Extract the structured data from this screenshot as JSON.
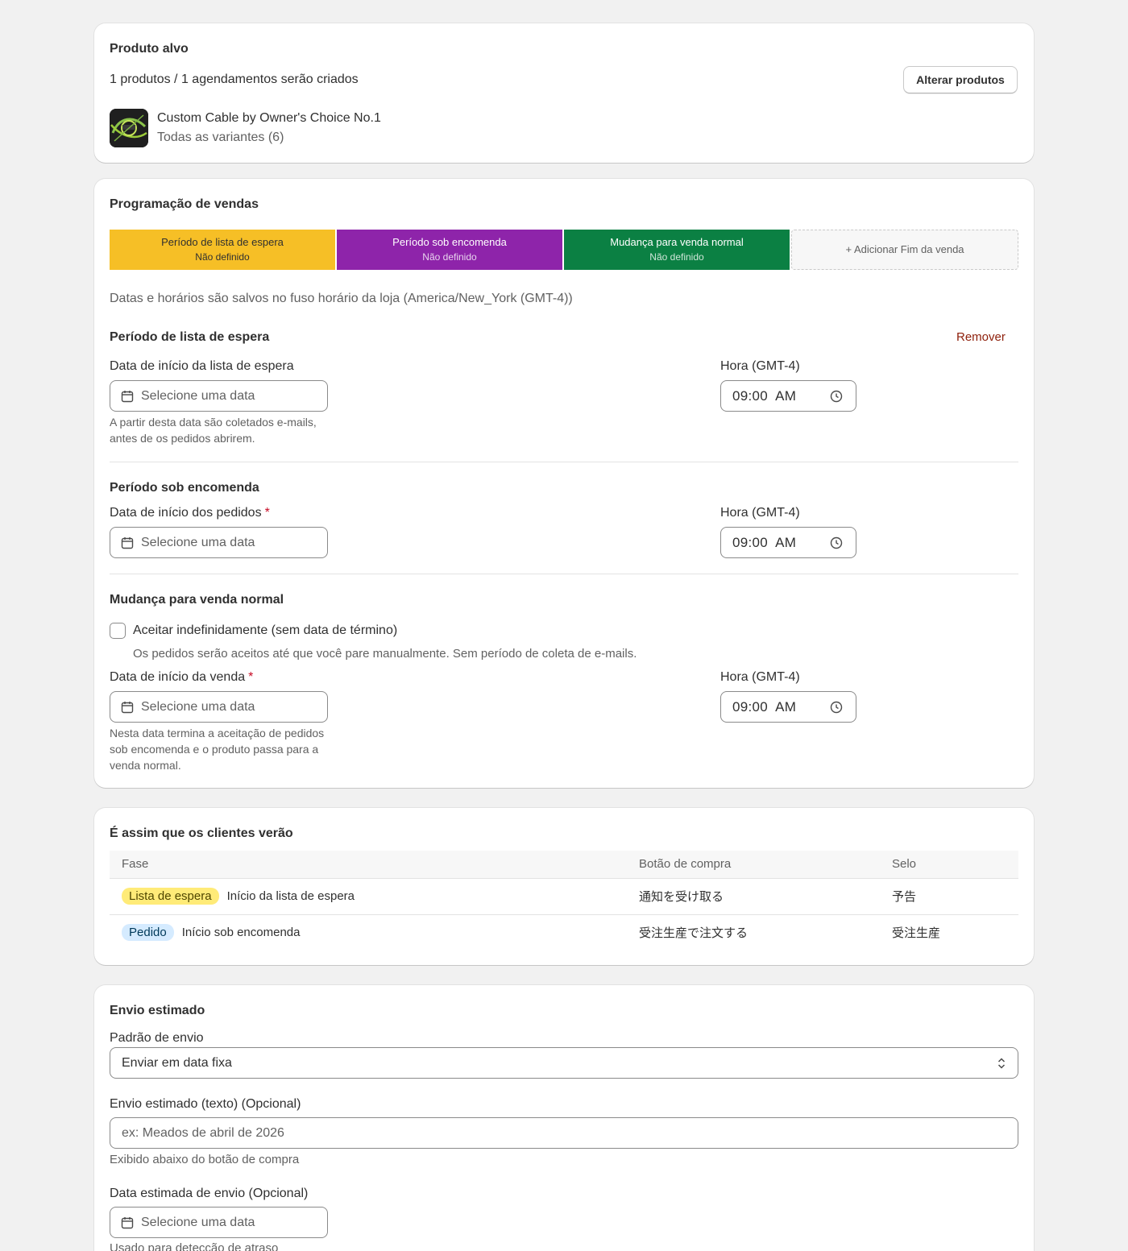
{
  "target_product": {
    "title": "Produto alvo",
    "summary": "1 produtos / 1 agendamentos serão criados",
    "change_button": "Alterar produtos",
    "product_name": "Custom Cable by Owner's Choice No.1",
    "variants": "Todas as variantes (6)"
  },
  "schedule": {
    "title": "Programação de vendas",
    "phases": [
      {
        "title": "Período de lista de espera",
        "status": "Não definido",
        "color": "#f6bf26",
        "text_color": "#303030"
      },
      {
        "title": "Período sob encomenda",
        "status": "Não definido",
        "color": "#8e24aa",
        "text_color": "#ffffff"
      },
      {
        "title": "Mudança para venda normal",
        "status": "Não definido",
        "color": "#0b8043",
        "text_color": "#ffffff"
      }
    ],
    "add_phase_label": "+ Adicionar Fim da venda",
    "timezone_note": "Datas e horários são salvos no fuso horário da loja (America/New_York (GMT-4))",
    "waitlist": {
      "title": "Período de lista de espera",
      "remove_label": "Remover",
      "start_label": "Data de início da lista de espera",
      "date_placeholder": "Selecione uma data",
      "help": "A partir desta data são coletados e-mails, antes de os pedidos abrirem.",
      "time_label": "Hora (GMT-4)",
      "time_value": "09:00  AM"
    },
    "preorder": {
      "title": "Período sob encomenda",
      "start_label": "Data de início dos pedidos",
      "required_mark": "*",
      "date_placeholder": "Selecione uma data",
      "time_label": "Hora (GMT-4)",
      "time_value": "09:00  AM"
    },
    "normal_sale": {
      "title": "Mudança para venda normal",
      "checkbox_label": "Aceitar indefinidamente (sem data de término)",
      "checkbox_help": "Os pedidos serão aceitos até que você pare manualmente. Sem período de coleta de e-mails.",
      "start_label": "Data de início da venda",
      "required_mark": "*",
      "date_placeholder": "Selecione uma data",
      "help": "Nesta data termina a aceitação de pedidos sob encomenda e o produto passa para a venda normal.",
      "time_label": "Hora (GMT-4)",
      "time_value": "09:00  AM"
    }
  },
  "preview": {
    "title": "É assim que os clientes verão",
    "columns": [
      "Fase",
      "Botão de compra",
      "Selo"
    ],
    "rows": [
      {
        "badge": "Lista de espera",
        "badge_color": "#ffeb78",
        "phase": "Início da lista de espera",
        "button": "通知を受け取る",
        "label": "予告"
      },
      {
        "badge": "Pedido",
        "badge_color": "#d5ebff",
        "phase": "Início sob encomenda",
        "button": "受注生産で注文する",
        "label": "受注生産"
      }
    ]
  },
  "shipping": {
    "title": "Envio estimado",
    "pattern_label": "Padrão de envio",
    "pattern_value": "Enviar em data fixa",
    "text_label": "Envio estimado (texto) (Opcional)",
    "text_placeholder": "ex: Meados de abril de 2026",
    "text_help": "Exibido abaixo do botão de compra",
    "date_label": "Data estimada de envio (Opcional)",
    "date_placeholder": "Selecione uma data",
    "date_help": "Usado para detecção de atraso"
  }
}
